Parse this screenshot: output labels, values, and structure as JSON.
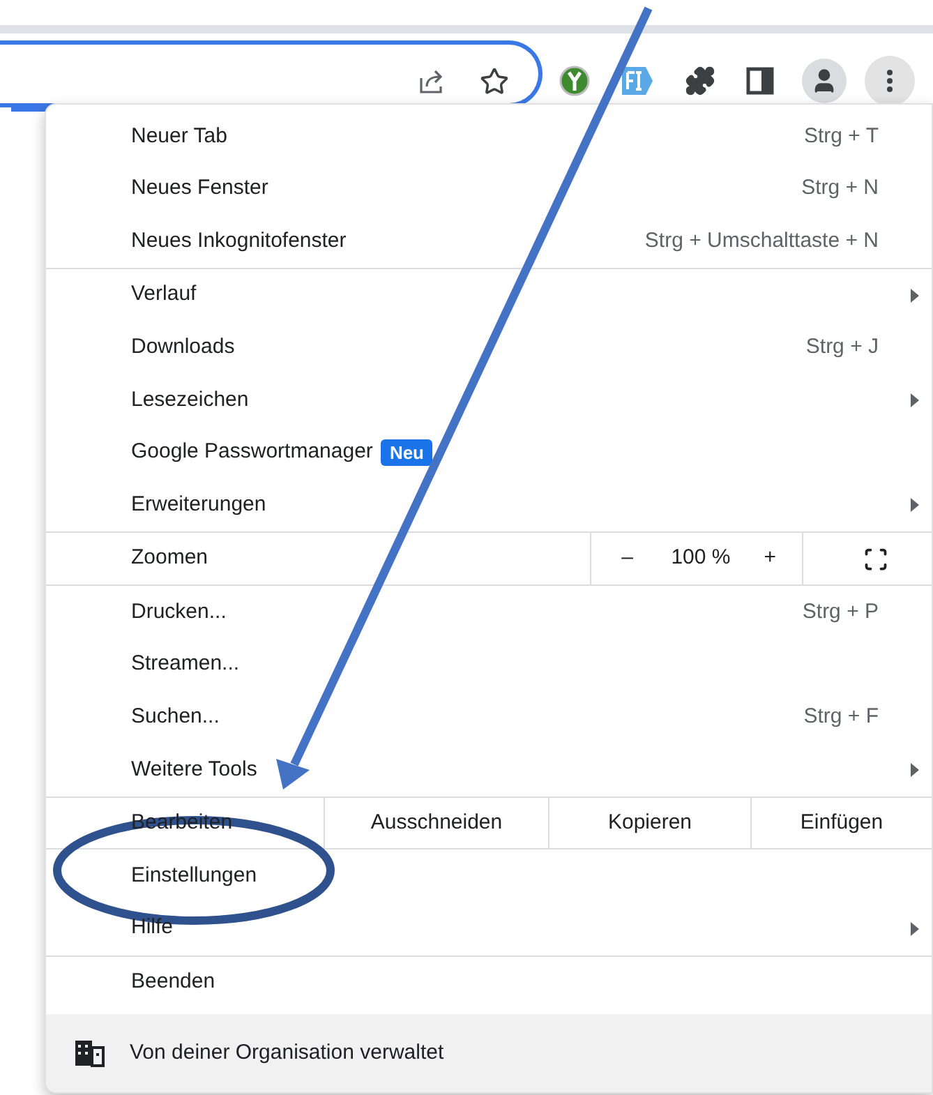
{
  "menu": {
    "sections": [
      {
        "items": [
          {
            "kind": "item",
            "label": "Neuer Tab",
            "shortcut": "Strg + T"
          },
          {
            "kind": "item",
            "label": "Neues Fenster",
            "shortcut": "Strg + N"
          },
          {
            "kind": "item",
            "label": "Neues Inkognitofenster",
            "shortcut": "Strg + Umschalttaste + N"
          }
        ]
      },
      {
        "items": [
          {
            "kind": "submenu",
            "label": "Verlauf"
          },
          {
            "kind": "item",
            "label": "Downloads",
            "shortcut": "Strg + J"
          },
          {
            "kind": "submenu",
            "label": "Lesezeichen"
          },
          {
            "kind": "item",
            "label": "Google Passwortmanager",
            "badge": "Neu"
          },
          {
            "kind": "submenu",
            "label": "Erweiterungen"
          }
        ]
      },
      {
        "items": [
          {
            "kind": "zoom",
            "label": "Zoomen",
            "minus": "–",
            "value": "100 %",
            "plus": "+"
          }
        ]
      },
      {
        "items": [
          {
            "kind": "item",
            "label": "Drucken...",
            "shortcut": "Strg + P"
          },
          {
            "kind": "item",
            "label": "Streamen..."
          },
          {
            "kind": "item",
            "label": "Suchen...",
            "shortcut": "Strg + F"
          },
          {
            "kind": "submenu",
            "label": "Weitere Tools"
          },
          {
            "kind": "edit",
            "label": "Bearbeiten",
            "actions": [
              "Ausschneiden",
              "Kopieren",
              "Einfügen"
            ]
          }
        ]
      },
      {
        "items": [
          {
            "kind": "item",
            "label": "Einstellungen"
          },
          {
            "kind": "submenu",
            "label": "Hilfe"
          }
        ]
      },
      {
        "items": [
          {
            "kind": "item",
            "label": "Beenden"
          }
        ]
      }
    ],
    "footer": "Von deiner Organisation verwaltet"
  }
}
